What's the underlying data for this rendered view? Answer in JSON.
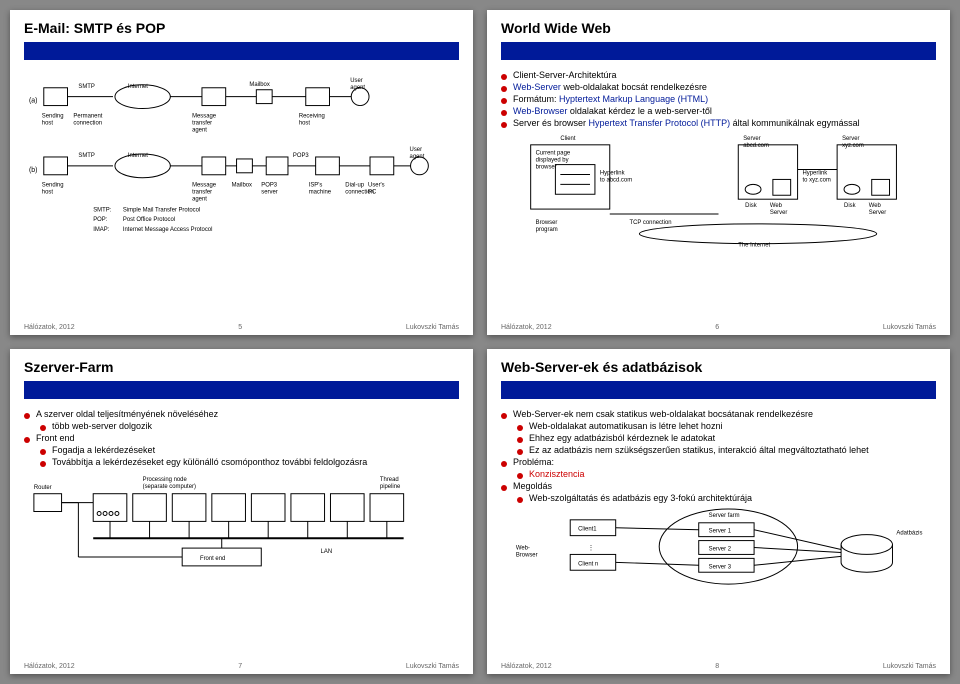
{
  "footer": {
    "left": "Hálózatok, 2012",
    "right": "Lukovszki Tamás"
  },
  "slide5": {
    "title": "E-Mail: SMTP és POP",
    "diag_a": {
      "row": "(a)",
      "n1": "Sending\nhost",
      "e1": "SMTP",
      "n2": "Permanent\nconnection",
      "e2": "Internet",
      "n3": "Message\ntransfer\nagent",
      "n4": "Mailbox",
      "n5": "Receiving\nhost",
      "n6": "User\nagent"
    },
    "diag_b": {
      "row": "(b)",
      "n1": "Sending\nhost",
      "e1": "SMTP",
      "e2": "Internet",
      "n3": "Message\ntransfer\nagent",
      "n4": "Mailbox",
      "n5": "POP3\nserver",
      "e3": "POP3",
      "n6": "ISP's\nmachine",
      "n7": "Dial-up\nconnection",
      "n8": "User's\nPC",
      "n9": "User\nagent"
    },
    "protocols": [
      {
        "k": "SMTP:",
        "v": "Simple Mail Transfer Protocol"
      },
      {
        "k": "POP:",
        "v": "Post Office Protocol"
      },
      {
        "k": "IMAP:",
        "v": "Internet Message Access Protocol"
      }
    ],
    "page": "5"
  },
  "slide6": {
    "title": "World Wide Web",
    "bullets": [
      {
        "t": "Client-Server-Architektúra"
      },
      {
        "t": "<span class='blue'>Web-Server</span> web-oldalakat bocsát rendelkezésre"
      },
      {
        "t": "Formátum: <span class='blue'>Hyptertext Markup Language (HTML)</span>"
      },
      {
        "t": "<span class='blue'>Web-Browser</span> oldalakat kérdez le a web-server-től"
      },
      {
        "t": "Server és browser <span class='blue'>Hypertext Transfer Protocol (HTTP)</span> által kommunikálnak egymással"
      }
    ],
    "diag": {
      "client": "Client",
      "cur": "Current page\ndisplayed by\nbrowser",
      "h1": "Hyperlink\nto abcd.com",
      "h2": "Hyperlink\nto xyz.com",
      "bp": "Browser\nprogram",
      "tcp": "TCP connection",
      "s1": "Server\nabcd.com",
      "s2": "Server\nxyz.com",
      "disk": "Disk",
      "ws": "Web\nServer",
      "inet": "The Internet"
    },
    "page": "6"
  },
  "slide7": {
    "title": "Szerver-Farm",
    "bullets": [
      {
        "t": "A szerver oldal teljesítményének növeléséhez",
        "sub": [
          {
            "t": "több web-server dolgozik"
          }
        ]
      },
      {
        "t": "Front end",
        "sub": [
          {
            "t": "Fogadja a lekérdezéseket"
          },
          {
            "t": "Továbbítja a lekérdezéseket egy különálló csomóponthoz további feldolgozásra"
          }
        ]
      }
    ],
    "diag": {
      "router": "Router",
      "proc": "Processing node\n(separate computer)",
      "thread": "Thread\npipeline",
      "fe": "Front end",
      "lan": "LAN"
    },
    "page": "7"
  },
  "slide8": {
    "title": "Web-Server-ek és adatbázisok",
    "bullets": [
      {
        "t": "Web-Server-ek nem csak statikus web-oldalakat bocsátanak rendelkezésre",
        "sub": [
          {
            "t": "Web-oldalakat automatikusan is létre lehet hozni"
          },
          {
            "t": "Ehhez egy adatbázisból kérdeznek le adatokat"
          },
          {
            "t": "Ez az adatbázis nem szükségszerűen statikus, interakció által megváltoztatható lehet"
          }
        ]
      },
      {
        "t": "Probléma:",
        "sub": [
          {
            "t": "<span class='red'>Konzisztencia</span>"
          }
        ]
      },
      {
        "t": "Megoldás",
        "sub": [
          {
            "t": "Web-szolgáltatás és adatbázis egy 3-fokú architektúrája"
          }
        ]
      }
    ],
    "diag": {
      "wb": "Web-\nBrowser",
      "c1": "Client1",
      "cn": "Client n",
      "sf": "Server farm",
      "s1": "Server 1",
      "s2": "Server 2",
      "s3": "Server 3",
      "db": "Adatbázis"
    },
    "page": "8"
  }
}
